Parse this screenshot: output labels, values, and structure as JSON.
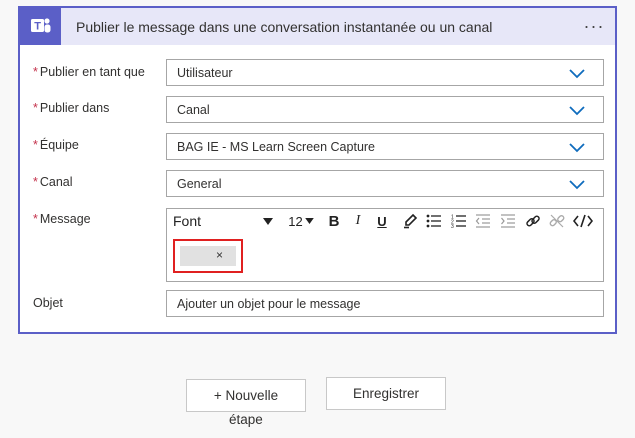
{
  "card": {
    "title": "Publier le message dans une conversation instantanée ou un canal",
    "menu_label": "···"
  },
  "fields": {
    "publier_en_tant_que": {
      "label": "Publier en tant que",
      "value": "Utilisateur"
    },
    "publier_dans": {
      "label": "Publier dans",
      "value": "Canal"
    },
    "equipe": {
      "label": "Équipe",
      "value": "BAG IE - MS Learn Screen Capture"
    },
    "canal": {
      "label": "Canal",
      "value": "General"
    },
    "message": {
      "label": "Message"
    },
    "objet": {
      "label": "Objet",
      "placeholder": "Ajouter un objet pour le message"
    }
  },
  "required_mark": "*",
  "editor": {
    "font_label": "Font",
    "size_label": "12",
    "bold": "B",
    "italic": "I",
    "underline": "U",
    "token_close": "×"
  },
  "footer": {
    "new_step_label": "+ Nouvelle",
    "new_step_label_2": "étape",
    "save_label": "Enregistrer"
  },
  "colors": {
    "accent": "#5b5fc7",
    "header_bg": "#e7e7f8",
    "chevron": "#0f6cbd",
    "required": "#c4314b",
    "highlight": "#e02020"
  },
  "icons": {
    "logo": "teams-logo-icon",
    "chevron": "chevron-down-icon",
    "highlighter": "highlighter-icon",
    "bulleted_list": "bulleted-list-icon",
    "numbered_list": "numbered-list-icon",
    "decrease_indent": "decrease-indent-icon",
    "increase_indent": "increase-indent-icon",
    "link": "link-icon",
    "unlink": "unlink-icon",
    "code_view": "code-view-icon"
  }
}
